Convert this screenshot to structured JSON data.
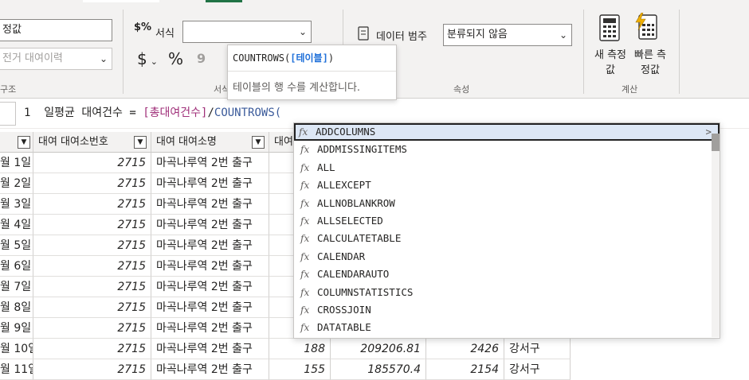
{
  "ribbon": {
    "structure": {
      "name_field": "정값",
      "table_field": "전거 대여이력",
      "group_label": "구조"
    },
    "format": {
      "format_icon": "$%",
      "format_label": "서식",
      "format_value": "",
      "currency_icon": "$",
      "percent_icon": "%",
      "comma_icon": "9",
      "group_label": "서식"
    },
    "properties": {
      "data_category_label": "데이터 범주",
      "data_category_value": "분류되지 않음",
      "group_label": "속성"
    },
    "calculations": {
      "new_measure_label": "새 측정값",
      "quick_measure_label": "빠른 측정값",
      "group_label": "계산"
    }
  },
  "formula": {
    "line_number": "1",
    "measure_name": "일평균 대여건수",
    "equals": " = ",
    "reference": "[총대여건수]",
    "operator": "/",
    "function_call": "COUNTROWS("
  },
  "tooltip": {
    "signature_fn": "COUNTROWS(",
    "signature_param": "[테이블]",
    "signature_end": ")",
    "description": "테이블의 행 수를 계산합니다."
  },
  "autocomplete": {
    "items": [
      "ADDCOLUMNS",
      "ADDMISSINGITEMS",
      "ALL",
      "ALLEXCEPT",
      "ALLNOBLANKROW",
      "ALLSELECTED",
      "CALCULATETABLE",
      "CALENDAR",
      "CALENDARAUTO",
      "COLUMNSTATISTICS",
      "CROSSJOIN",
      "DATATABLE"
    ],
    "fx_symbol": "fx",
    "selected_arrow": ">"
  },
  "table": {
    "columns": [
      "대여 대여소번호",
      "대여 대여소명",
      "대여"
    ],
    "rows": [
      {
        "date": "월 1일",
        "station_no": "2715",
        "station_name": "마곡나루역 2번 출구"
      },
      {
        "date": "월 2일",
        "station_no": "2715",
        "station_name": "마곡나루역 2번 출구"
      },
      {
        "date": "월 3일",
        "station_no": "2715",
        "station_name": "마곡나루역 2번 출구"
      },
      {
        "date": "월 4일",
        "station_no": "2715",
        "station_name": "마곡나루역 2번 출구"
      },
      {
        "date": "월 5일",
        "station_no": "2715",
        "station_name": "마곡나루역 2번 출구"
      },
      {
        "date": "월 6일",
        "station_no": "2715",
        "station_name": "마곡나루역 2번 출구"
      },
      {
        "date": "월 7일",
        "station_no": "2715",
        "station_name": "마곡나루역 2번 출구"
      },
      {
        "date": "월 8일",
        "station_no": "2715",
        "station_name": "마곡나루역 2번 출구"
      },
      {
        "date": "월 9일",
        "station_no": "2715",
        "station_name": "마곡나루역 2번 출구"
      },
      {
        "date": "월 10일",
        "station_no": "2715",
        "station_name": "마곡나루역 2번 출구",
        "c4": "188",
        "c5": "209206.81",
        "c6": "2426",
        "c7": "강서구"
      },
      {
        "date": "월 11일",
        "station_no": "2715",
        "station_name": "마곡나루역 2번 출구",
        "c4": "155",
        "c5": "185570.4",
        "c6": "2154",
        "c7": "강서구"
      }
    ]
  }
}
